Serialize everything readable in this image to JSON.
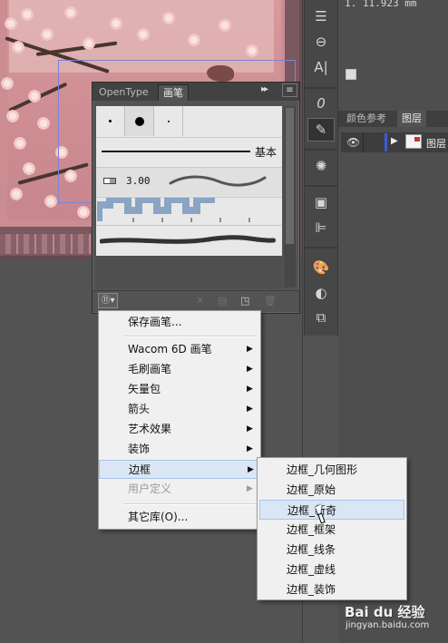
{
  "canvas": {
    "artwork": "plum-blossom-painting",
    "selection_color": "#7d84d6"
  },
  "top_readout": "1. 11.923 mm",
  "tools": [
    {
      "icon": "menu-lines-icon"
    },
    {
      "icon": "link-icon"
    },
    {
      "icon": "character-icon"
    },
    {
      "icon": "opentype-icon"
    },
    {
      "icon": "brushes-icon"
    },
    {
      "icon": "symbols-icon"
    },
    {
      "icon": "gradient-icon"
    },
    {
      "icon": "align-icon"
    },
    {
      "icon": "swatches-palette-icon"
    },
    {
      "icon": "transparency-icon"
    },
    {
      "icon": "pathfinder-icon"
    }
  ],
  "right_dock": {
    "tabs": [
      "颜色参考",
      "图层"
    ],
    "active_tab": "图层",
    "layer": {
      "name": "图层",
      "color": "#3b5bd8"
    }
  },
  "brush_panel": {
    "tabs": [
      "OpenType",
      "画笔"
    ],
    "active_tab": "画笔",
    "collapse_label": "▸▸",
    "menu_label": "≡",
    "basic_brush_label": "基本",
    "calligraphic_value": "3.00",
    "libraries_button_label": "⑪▾"
  },
  "menu": {
    "items": [
      {
        "label": "保存画笔...",
        "arrow": false
      },
      {
        "label": "Wacom 6D 画笔",
        "arrow": true
      },
      {
        "label": "毛刷画笔",
        "arrow": true
      },
      {
        "label": "矢量包",
        "arrow": true
      },
      {
        "label": "箭头",
        "arrow": true
      },
      {
        "label": "艺术效果",
        "arrow": true
      },
      {
        "label": "装饰",
        "arrow": true
      },
      {
        "label": "边框",
        "arrow": true,
        "highlighted": true
      },
      {
        "label": "用户定义",
        "arrow": true,
        "disabled": true
      },
      {
        "label": "其它库(O)...",
        "arrow": false
      }
    ],
    "arrow_glyph": "▶"
  },
  "submenu": {
    "items": [
      "边框_几何图形",
      "边框_原始",
      "边框_新奇",
      "边框_框架",
      "边框_线条",
      "边框_虚线",
      "边框_装饰"
    ],
    "highlighted": "边框_新奇"
  },
  "watermark": {
    "text": "Bai du 经验",
    "url": "jingyan.baidu.com"
  }
}
